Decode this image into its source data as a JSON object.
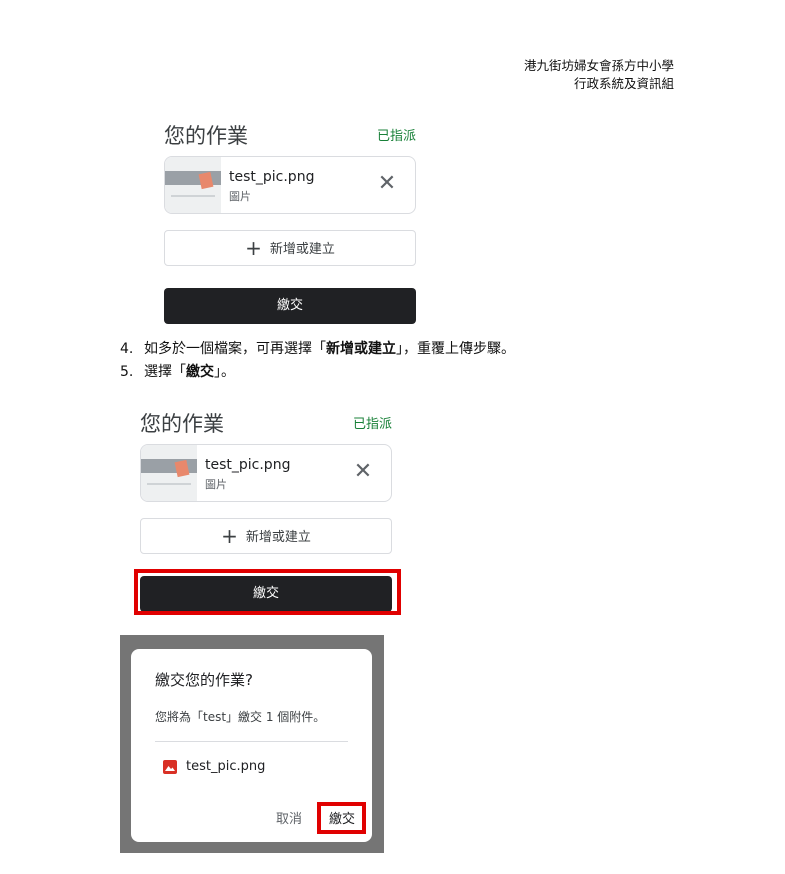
{
  "header": {
    "line1": "港九街坊婦女會孫方中小學",
    "line2": "行政系統及資訊組"
  },
  "card1": {
    "title": "您的作業",
    "status": "已指派",
    "attachment": {
      "filename": "test_pic.png",
      "type": "圖片"
    },
    "add_label": "新增或建立",
    "submit_label": "繳交"
  },
  "steps": [
    {
      "num": "4.",
      "pre": "如多於一個檔案，可再選擇「",
      "bold": "新增或建立",
      "post": "」，重覆上傳步驟。"
    },
    {
      "num": "5.",
      "pre": "選擇「",
      "bold": "繳交",
      "post": "」。"
    }
  ],
  "card2": {
    "title": "您的作業",
    "status": "已指派",
    "attachment": {
      "filename": "test_pic.png",
      "type": "圖片"
    },
    "add_label": "新增或建立",
    "submit_label": "繳交"
  },
  "dialog": {
    "title": "繳交您的作業?",
    "message": "您將為「test」繳交 1 個附件。",
    "file": "test_pic.png",
    "cancel": "取消",
    "submit": "繳交"
  },
  "colors": {
    "assigned": "#188038",
    "submit_bg": "#202124",
    "highlight": "#e00000",
    "file_icon": "#d93025"
  },
  "icons": [
    "plus-icon",
    "close-icon",
    "image-file-icon"
  ]
}
